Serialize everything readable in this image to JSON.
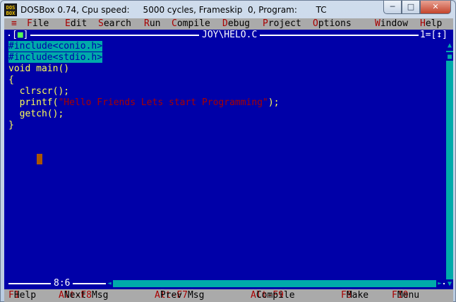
{
  "window": {
    "icon_text": "DOS BOX",
    "title": "DOSBox 0.74, Cpu speed:     5000 cycles, Frameskip  0, Program:       TC",
    "minimize": "─",
    "maximize": "□",
    "close": "✕"
  },
  "menu": {
    "system": "≡",
    "items": [
      {
        "hot": "F",
        "rest": "ile"
      },
      {
        "hot": "E",
        "rest": "dit"
      },
      {
        "hot": "S",
        "rest": "earch"
      },
      {
        "hot": "R",
        "rest": "un"
      },
      {
        "hot": "C",
        "rest": "ompile"
      },
      {
        "hot": "D",
        "rest": "ebug"
      },
      {
        "hot": "P",
        "rest": "roject"
      },
      {
        "hot": "O",
        "rest": "ptions"
      },
      {
        "hot": "W",
        "rest": "indow"
      },
      {
        "hot": "H",
        "rest": "elp"
      }
    ]
  },
  "editor": {
    "close_box_open": "[",
    "close_box_mark": "■",
    "close_box_close": "]",
    "filename": "JOY\\HELO.C",
    "window_number": "1=",
    "zoom_box": "[↕]",
    "lines": [
      {
        "pre": "",
        "text": "#include<conio.h>",
        "str": "",
        "post": "",
        "selected": true
      },
      {
        "pre": "",
        "text": "#include<stdio.h>",
        "str": "",
        "post": "",
        "selected": true
      },
      {
        "pre": "void main()",
        "text": "",
        "str": "",
        "post": ""
      },
      {
        "pre": "{",
        "text": "",
        "str": "",
        "post": ""
      },
      {
        "pre": "  clrscr();",
        "text": "",
        "str": "",
        "post": ""
      },
      {
        "pre": "  printf(",
        "text": "",
        "str": "\"Hello Friends Lets start Programming\"",
        "post": ");"
      },
      {
        "pre": "  getch();",
        "text": "",
        "str": "",
        "post": ""
      },
      {
        "pre": "}",
        "text": "",
        "str": "",
        "post": ""
      }
    ],
    "cursor_position": "8:6",
    "scroll_up": "▲",
    "scroll_down": "▼",
    "scroll_left": "◄",
    "scroll_right": "►",
    "scroll_thumb": "■"
  },
  "status": [
    {
      "key": "F1",
      "label": " Help"
    },
    {
      "key": "Alt-F8",
      "label": " Next Msg"
    },
    {
      "key": "Alt-F7",
      "label": " Prev Msg"
    },
    {
      "key": "Alt-F9",
      "label": " Compile"
    },
    {
      "key": "F9",
      "label": " Make"
    },
    {
      "key": "F10",
      "label": " Menu"
    }
  ],
  "colors": {
    "background": "#0000a8",
    "menu_bg": "#aaaaaa",
    "hotkey": "#a80000",
    "code": "#ffff55",
    "selection": "#00aaaa"
  }
}
